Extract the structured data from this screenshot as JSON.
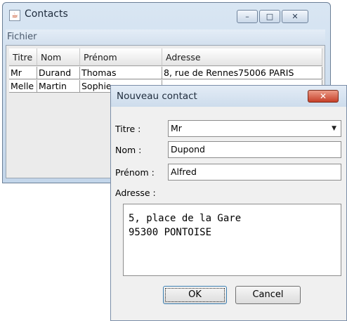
{
  "main_window": {
    "title": "Contacts",
    "icon": "java-cup-icon",
    "controls": {
      "minimize": "–",
      "maximize": "□",
      "close": "✕"
    },
    "menu": [
      "Fichier"
    ]
  },
  "table": {
    "columns": [
      "Titre",
      "Nom",
      "Prénom",
      "Adresse"
    ],
    "rows": [
      [
        "Mr",
        "Durand",
        "Thomas",
        "8, rue de Rennes75006 PARIS"
      ],
      [
        "Melle",
        "Martin",
        "Sophie",
        ""
      ]
    ]
  },
  "dialog": {
    "title": "Nouveau contact",
    "close": "✕",
    "titre_label": "Titre :",
    "titre_value": "Mr",
    "nom_label": "Nom :",
    "nom_value": "Dupond",
    "prenom_label": "Prénom :",
    "prenom_value": "Alfred",
    "adresse_label": "Adresse :",
    "adresse_lines": [
      "5, place de la Gare",
      "95300 PONTOISE"
    ],
    "ok_label": "OK",
    "cancel_label": "Cancel"
  },
  "colors": {
    "title_gradient_top": "#d9e6f3",
    "close_red": "#c6412a"
  }
}
